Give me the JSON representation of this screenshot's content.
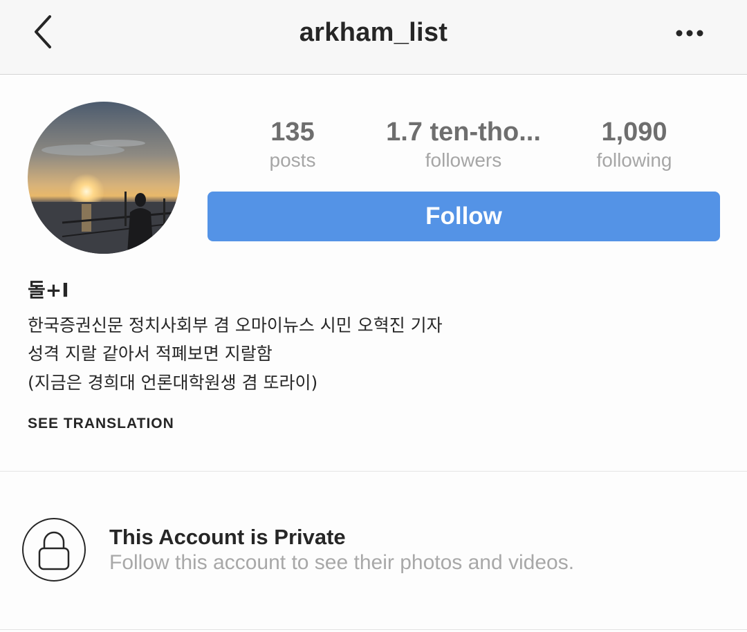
{
  "header": {
    "title": "arkham_list",
    "back_icon": "chevron-left-icon",
    "more_icon": "more-horizontal-icon"
  },
  "profile": {
    "avatar_icon": "profile-photo-sunset",
    "stats": [
      {
        "value": "135",
        "label": "posts"
      },
      {
        "value": "1.7 ten-tho...",
        "label": "followers"
      },
      {
        "value": "1,090",
        "label": "following"
      }
    ],
    "follow_label": "Follow",
    "follow_color": "#5493e6"
  },
  "bio": {
    "name": "돌+I",
    "lines": [
      "한국증권신문 정치사회부 겸 오마이뉴스 시민 오혁진 기자",
      "성격 지랄 같아서 적폐보면 지랄함",
      "(지금은 경희대 언론대학원생 겸 또라이)"
    ],
    "see_translation": "SEE TRANSLATION"
  },
  "private": {
    "icon": "lock-icon",
    "title": "This Account is Private",
    "subtitle": "Follow this account to see their photos and videos."
  }
}
